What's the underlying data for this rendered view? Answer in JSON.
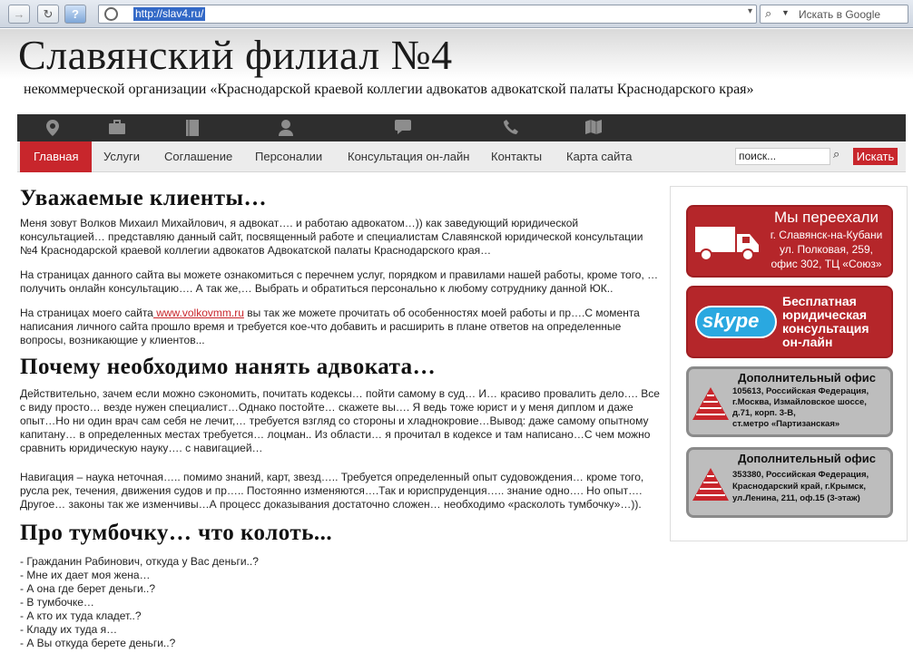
{
  "browser": {
    "url": "http://slav4.ru/",
    "search_placeholder": "Искать в Google"
  },
  "site": {
    "title": "Славянский филиал №4",
    "subtitle": "некоммерческой организации «Краснодарской краевой коллегии адвокатов адвокатской палаты Краснодарского края»"
  },
  "nav": {
    "icons": [
      "map-pin-icon",
      "briefcase-icon",
      "book-icon",
      "person-icon",
      "chat-icon",
      "phone-icon",
      "map-icon"
    ],
    "items": [
      {
        "label": "Главная",
        "active": true
      },
      {
        "label": "Услуги"
      },
      {
        "label": "Соглашение"
      },
      {
        "label": "Персоналии"
      },
      {
        "label": "Консультация он-лайн"
      },
      {
        "label": "Контакты"
      },
      {
        "label": "Карта сайта"
      }
    ],
    "search_value": "поиск...",
    "search_button": "Искать"
  },
  "content": {
    "h1": "Уважаемые клиенты…",
    "p1": "Меня зовут Волков Михаил Михайлович, я адвокат…. и работаю адвокатом…)) как заведующий юридической консультацией… представляю данный сайт, посвященный работе и специалистам Славянской юридической консультации №4 Краснодарской краевой коллегии адвокатов Адвокатской палаты Краснодарского края…",
    "p2": "На страницах данного сайта вы можете ознакомиться с перечнем услуг, порядком и правилами нашей работы, кроме того, … получить онлайн консультацию…. А так же,… Выбрать и обратиться персонально к любому сотруднику данной ЮК..",
    "p3_before": "На страницах моего сайта",
    "p3_link": " www.volkovmm.ru",
    "p3_after": " вы так же можете прочитать об особенностях моей работы и пр….С момента написания личного сайта прошло время и требуется кое-что добавить и расширить в плане ответов на определенные вопросы, возникающие у клиентов...",
    "h2": "Почему необходимо нанять адвоката…",
    "p4": "Действительно, зачем если можно сэкономить, почитать кодексы… пойти самому в суд… И… красиво провалить дело…. Все с виду просто… везде нужен специалист…Однако постойте… скажете вы…. Я ведь тоже юрист и у меня диплом и даже опыт…Но ни один врач сам себя не лечит,… требуется взгляд со стороны и хладнокровие…Вывод: даже самому опытному капитану… в определенных местах требуется… лоцман.. Из области… я прочитал в кодексе и там написано…С чем можно сравнить юридическую науку…. с навигацией…",
    "p5": "Навигация – наука неточная….. помимо знаний, карт, звезд….. Требуется определенный опыт судовождения… кроме того, русла рек, течения, движения судов и пр….. Постоянно изменяются….Так и юриспруденция….. знание одно…. Но опыт…. Другое… законы так же изменчивы…А процесс доказывания достаточно сложен… необходимо «расколоть тумбочку»…)).",
    "h3": "Про тумбочку… что колоть...",
    "dialog": [
      "- Гражданин Рабинович, откуда у Вас деньги..?",
      "- Мне их дает моя жена…",
      "- А она где берет деньги..?",
      "- В тумбочке…",
      "- А кто их туда кладет..?",
      "- Кладу их туда я…",
      "- А Вы откуда берете деньги..?"
    ]
  },
  "sidebar": {
    "moved": {
      "title": "Мы переехали",
      "line1": "г. Славянск-на-Кубани",
      "line2": "ул. Полковая, 259,",
      "line3": "офис 302, ТЦ «Союз»"
    },
    "skype": {
      "logo": "skype",
      "line1": "Бесплатная",
      "line2": "юридическая",
      "line3": "консультация",
      "line4": "он-лайн"
    },
    "office1": {
      "title": "Дополнительный офис",
      "line1": "105613, Российская Федерация,",
      "line2": "г.Москва, Измайловское шоссе,",
      "line3": "д.71, корп. 3-В,",
      "line4": "ст.метро «Партизанская»"
    },
    "office2": {
      "title": "Дополнительный офис",
      "line1": "353380, Российская Федерация,",
      "line2": "Краснодарский край, г.Крымск,",
      "line3": "ул.Ленина, 211, оф.15 (3-этаж)"
    }
  },
  "colors": {
    "accent": "#c8262c",
    "nav_dark": "#2e2e2e"
  }
}
